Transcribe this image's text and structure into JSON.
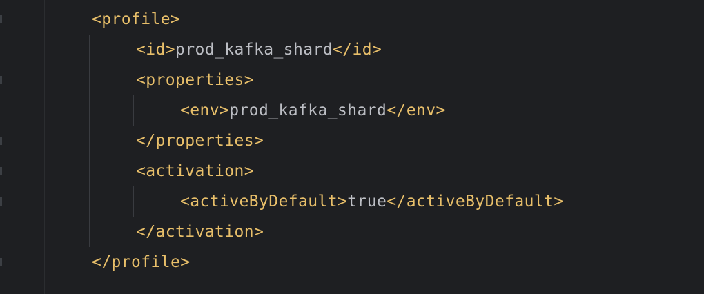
{
  "editor": {
    "language": "xml",
    "colors": {
      "background": "#1e1f22",
      "tag": "#e8bf6a",
      "text": "#bcbec4",
      "indent_guide": "#393b40"
    },
    "lines": [
      {
        "open": "<profile>"
      },
      {
        "open": "<id>",
        "value": "prod_kafka_shard",
        "close": "</id>"
      },
      {
        "open": "<properties>"
      },
      {
        "open": "<env>",
        "value": "prod_kafka_shard",
        "close": "</env>"
      },
      {
        "close": "</properties>"
      },
      {
        "open": "<activation>"
      },
      {
        "open": "<activeByDefault>",
        "value": "true",
        "close": "</activeByDefault>"
      },
      {
        "close": "</activation>"
      },
      {
        "close": "</profile>"
      }
    ]
  }
}
